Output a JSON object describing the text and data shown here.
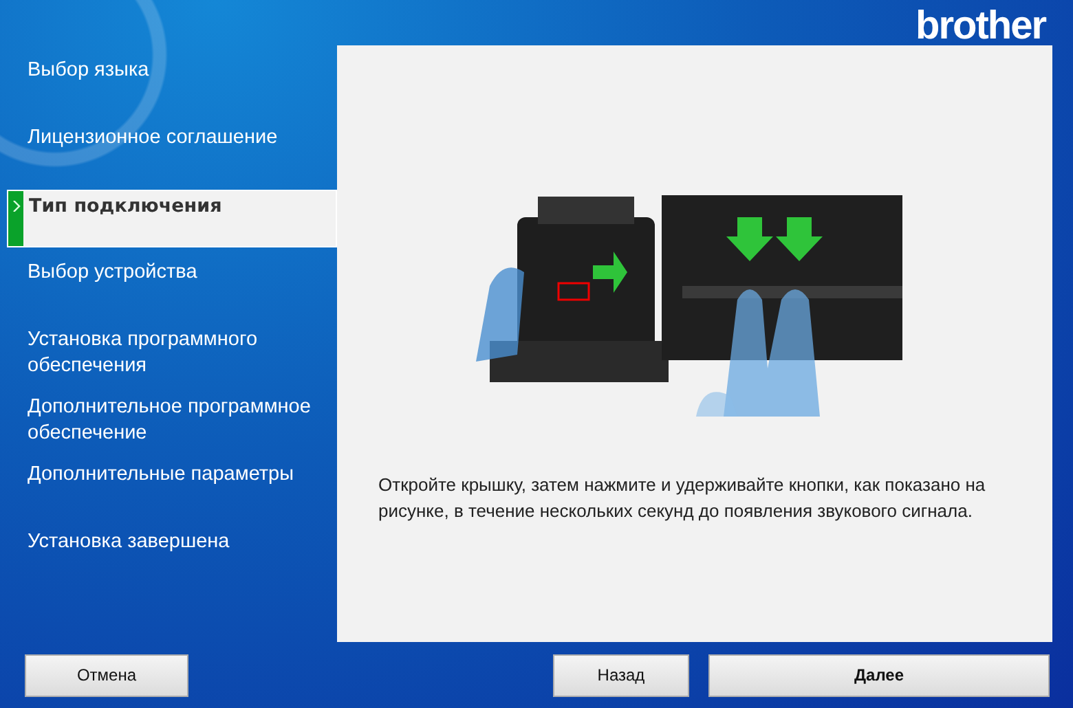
{
  "logo": "brother",
  "steps": [
    {
      "label": "Выбор языка",
      "selected": false
    },
    {
      "label": "Лицензионное соглашение",
      "selected": false
    },
    {
      "label": "Тип подключения",
      "selected": true
    },
    {
      "label": "Выбор устройства",
      "selected": false
    },
    {
      "label": "Установка программного обеспечения",
      "selected": false
    },
    {
      "label": "Дополнительное программное обеспечение",
      "selected": false
    },
    {
      "label": "Дополнительные параметры",
      "selected": false
    },
    {
      "label": "Установка завершена",
      "selected": false
    }
  ],
  "content": {
    "instruction": "Откройте крышку, затем нажмите и удерживайте кнопки, как показано на рисунке, в течение нескольких секунд до появления звукового сигнала."
  },
  "buttons": {
    "cancel": "Отмена",
    "back": "Назад",
    "next": "Далее"
  }
}
